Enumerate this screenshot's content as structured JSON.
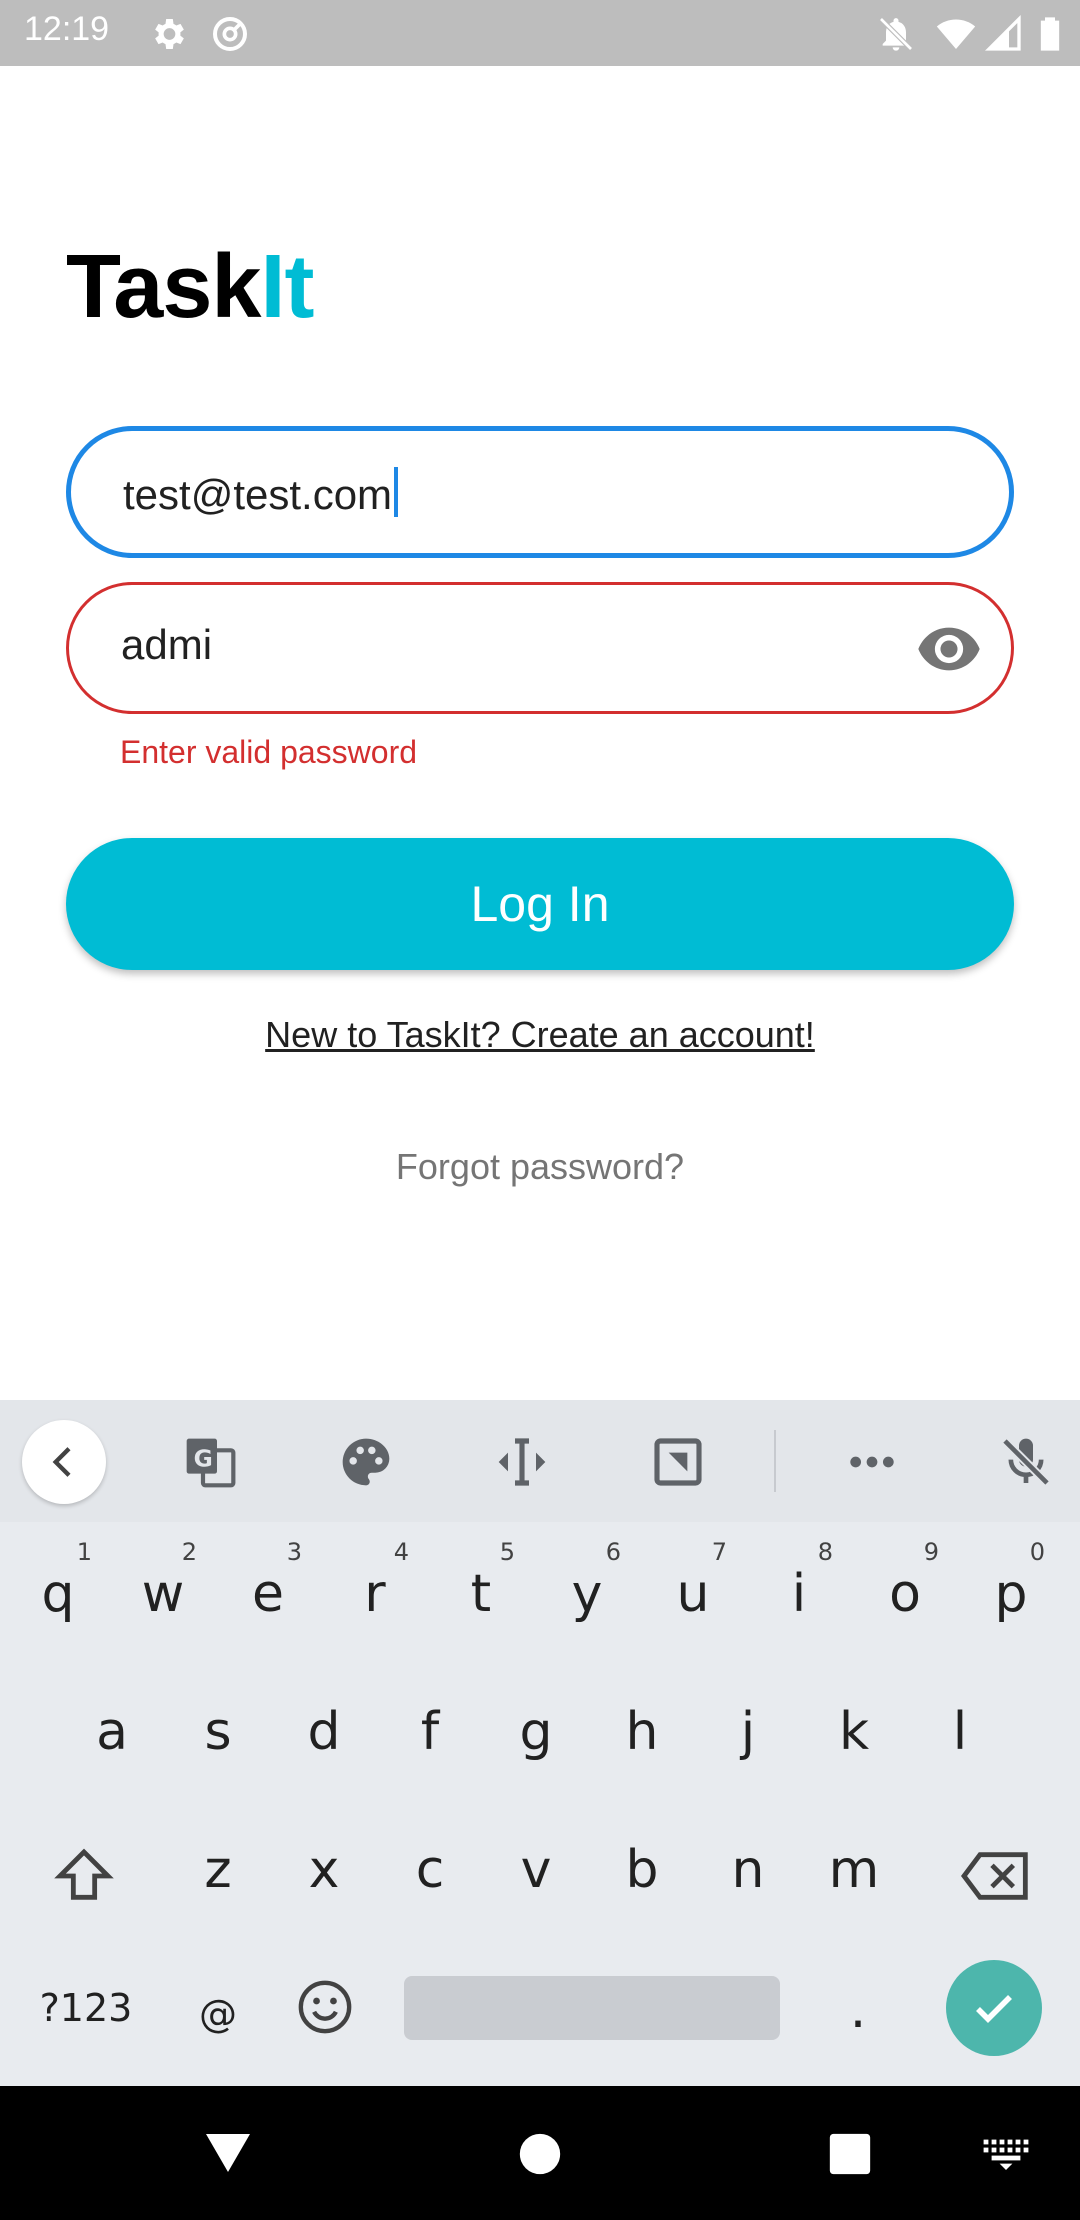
{
  "status_bar": {
    "time": "12:19",
    "icons": [
      "settings-icon",
      "do-not-disturb-icon",
      "notifications-off-icon",
      "wifi-icon",
      "cellular-signal-icon",
      "battery-icon"
    ]
  },
  "app": {
    "logo_part1": "Task",
    "logo_part2": "It",
    "accent_color": "#00bcd4",
    "email_value": "test@test.com",
    "password_value": "admi",
    "password_error": "Enter valid password",
    "login_label": "Log In",
    "create_account_link": "New to TaskIt? Create an account!",
    "forgot_password_link": "Forgot password?"
  },
  "keyboard": {
    "toolbar_icons": [
      "chevron-left-icon",
      "translate-icon",
      "palette-icon",
      "text-cursor-icon",
      "one-handed-icon",
      "more-icon",
      "mic-off-icon"
    ],
    "row1": [
      {
        "k": "q",
        "h": "1"
      },
      {
        "k": "w",
        "h": "2"
      },
      {
        "k": "e",
        "h": "3"
      },
      {
        "k": "r",
        "h": "4"
      },
      {
        "k": "t",
        "h": "5"
      },
      {
        "k": "y",
        "h": "6"
      },
      {
        "k": "u",
        "h": "7"
      },
      {
        "k": "i",
        "h": "8"
      },
      {
        "k": "o",
        "h": "9"
      },
      {
        "k": "p",
        "h": "0"
      }
    ],
    "row2": [
      "a",
      "s",
      "d",
      "f",
      "g",
      "h",
      "j",
      "k",
      "l"
    ],
    "row3": [
      "z",
      "x",
      "c",
      "v",
      "b",
      "n",
      "m"
    ],
    "symbols_label": "?123",
    "at_label": "@",
    "period_label": ".",
    "enter_color": "#4db6ac"
  },
  "nav_bar": {
    "icons": [
      "back-icon",
      "home-icon",
      "recents-icon",
      "keyboard-switch-icon"
    ]
  }
}
